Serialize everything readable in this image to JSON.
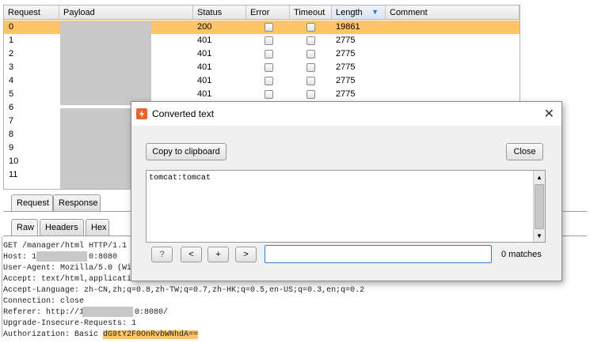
{
  "table": {
    "columns": [
      "Request",
      "Payload",
      "Status",
      "Error",
      "Timeout",
      "Length",
      "Comment"
    ],
    "rows": [
      {
        "request": "0",
        "status": "200",
        "length": "19861"
      },
      {
        "request": "1",
        "status": "401",
        "length": "2775"
      },
      {
        "request": "2",
        "status": "401",
        "length": "2775"
      },
      {
        "request": "3",
        "status": "401",
        "length": "2775"
      },
      {
        "request": "4",
        "status": "401",
        "length": "2775"
      },
      {
        "request": "5",
        "status": "401",
        "length": "2775"
      },
      {
        "request": "6",
        "status": "",
        "length": ""
      },
      {
        "request": "7",
        "status": "",
        "length": ""
      },
      {
        "request": "8",
        "status": "",
        "length": ""
      },
      {
        "request": "9",
        "status": "",
        "length": ""
      },
      {
        "request": "10",
        "status": "",
        "length": ""
      },
      {
        "request": "11",
        "status": "",
        "length": ""
      }
    ],
    "selected_row": 0
  },
  "tabs": {
    "top": [
      "Request",
      "Response"
    ],
    "sub": [
      "Raw",
      "Headers",
      "Hex"
    ]
  },
  "request_lines": [
    "GET /manager/html HTTP/1.1",
    "Host: 1",
    "0:8080",
    "User-Agent: Mozilla/5.0 (Wi",
    "Accept: text/html,applicati",
    "Accept-Language: zh-CN,zh;q=0.8,zh-TW;q=0.7,zh-HK;q=0.5,en-US;q=0.3,en;q=0.2",
    "Connection: close",
    "Referer: http://1",
    "0:8080/",
    "Upgrade-Insecure-Requests: 1",
    "Authorization: Basic ",
    "dG9tY2F0OnRvbWNhdA=="
  ],
  "dialog": {
    "title": "Converted text",
    "close_glyph": "✕",
    "copy_label": "Copy to clipboard",
    "close_label": "Close",
    "content": "tomcat:tomcat",
    "help_label": "?",
    "prev_label": "<",
    "add_label": "+",
    "next_label": ">",
    "search_value": "",
    "matches": "0 matches"
  },
  "colors": {
    "selection": "#ffc466",
    "accent": "#3d7bd1",
    "logo": "#e8662a"
  }
}
